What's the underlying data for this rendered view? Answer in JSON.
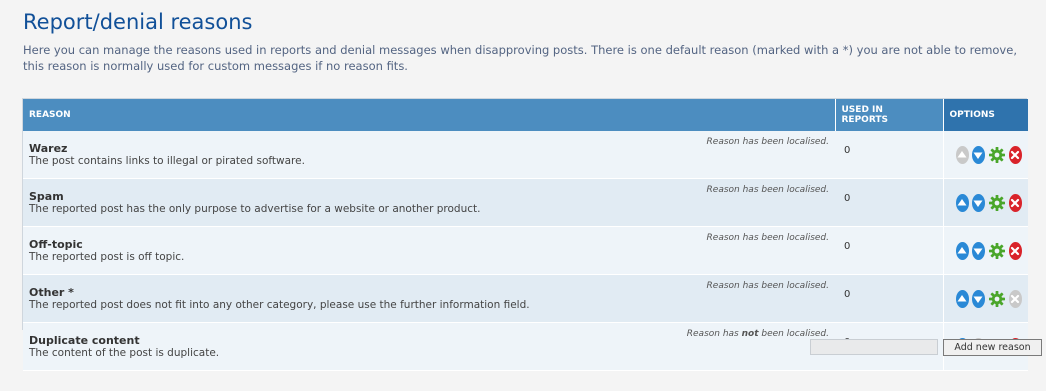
{
  "header": {
    "title": "Report/denial reasons",
    "description": "Here you can manage the reasons used in reports and denial messages when disapproving posts. There is one default reason (marked with a *) you are not able to remove, this reason is normally used for custom messages if no reason fits."
  },
  "table": {
    "columns": {
      "reason": "Reason",
      "used_line1": "Used in",
      "used_line2": "reports",
      "options": "Options"
    },
    "rows": [
      {
        "name": "Warez",
        "description": "The post contains links to illegal or pirated software.",
        "localised": "Reason has been localised.",
        "used": "0",
        "up": "disabled",
        "down": "enabled",
        "edit": "enabled",
        "delete": "enabled"
      },
      {
        "name": "Spam",
        "description": "The reported post has the only purpose to advertise for a website or another product.",
        "localised": "Reason has been localised.",
        "used": "0",
        "up": "enabled",
        "down": "enabled",
        "edit": "enabled",
        "delete": "enabled"
      },
      {
        "name": "Off-topic",
        "description": "The reported post is off topic.",
        "localised": "Reason has been localised.",
        "used": "0",
        "up": "enabled",
        "down": "enabled",
        "edit": "enabled",
        "delete": "enabled"
      },
      {
        "name": "Other *",
        "description": "The reported post does not fit into any other category, please use the further information field.",
        "localised": "Reason has been localised.",
        "used": "0",
        "up": "enabled",
        "down": "enabled",
        "edit": "enabled",
        "delete": "disabled"
      },
      {
        "name": "Duplicate content",
        "description": "The content of the post is duplicate.",
        "localised": "Reason has not been localised.",
        "used": "0",
        "up": "enabled",
        "down": "disabled",
        "edit": "enabled",
        "delete": "enabled"
      }
    ]
  },
  "icons": {
    "move_up": "move-up-icon",
    "move_down": "move-down-icon",
    "edit": "edit-gear-icon",
    "delete": "delete-icon"
  },
  "footer": {
    "new_reason_value": "",
    "add_button_label": "Add new reason"
  },
  "colors": {
    "title": "#115098",
    "header_bg": "#4c8dc0",
    "options_header_bg": "#2f73ad",
    "arrow_blue": "#2a89d6",
    "gear_green": "#4aa62a",
    "delete_red": "#d9232a",
    "disabled_grey": "#c9c9c9"
  }
}
